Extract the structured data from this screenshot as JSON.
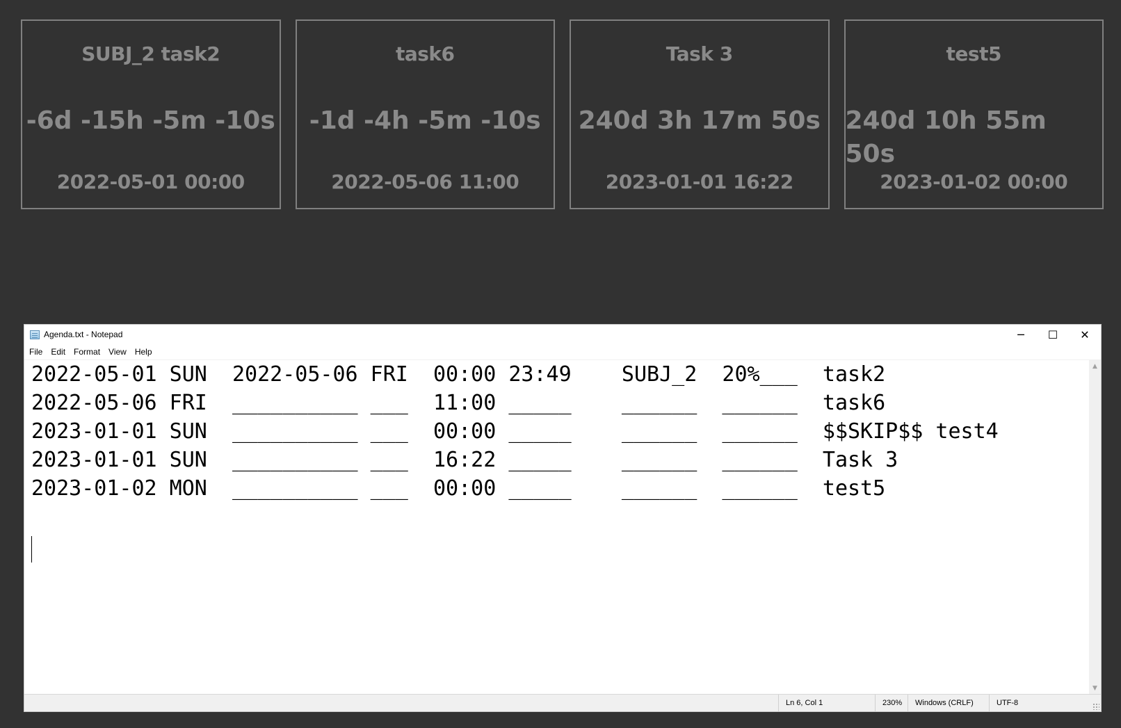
{
  "countdown_cards": [
    {
      "title": "SUBJ_2 task2",
      "countdown": "-6d -15h -5m -10s",
      "datetime": "2022-05-01 00:00"
    },
    {
      "title": "task6",
      "countdown": "-1d -4h -5m -10s",
      "datetime": "2022-05-06 11:00"
    },
    {
      "title": "Task 3",
      "countdown": "240d 3h 17m 50s",
      "datetime": "2023-01-01 16:22"
    },
    {
      "title": "test5",
      "countdown": "240d 10h 55m 50s",
      "datetime": "2023-01-02 00:00"
    }
  ],
  "notepad": {
    "window_title": "Agenda.txt - Notepad",
    "icons": {
      "app": "notepad-icon",
      "minimize": "minimize-icon",
      "maximize": "maximize-icon",
      "close": "close-icon"
    },
    "controls": {
      "minimize": "─",
      "maximize": "☐",
      "close": "✕"
    },
    "menu": [
      "File",
      "Edit",
      "Format",
      "View",
      "Help"
    ],
    "lines": [
      "2022-05-01 SUN  2022-05-06 FRI  00:00 23:49    SUBJ_2  20%___  task2",
      "2022-05-06 FRI  __________ ___  11:00 _____    ______  ______  task6",
      "2023-01-01 SUN  __________ ___  00:00 _____    ______  ______  $$SKIP$$ test4",
      "2023-01-01 SUN  __________ ___  16:22 _____    ______  ______  Task 3",
      "2023-01-02 MON  __________ ___  00:00 _____    ______  ______  test5"
    ],
    "status": {
      "position": "Ln 6, Col 1",
      "zoom": "230%",
      "line_ending": "Windows (CRLF)",
      "encoding": "UTF-8"
    }
  }
}
